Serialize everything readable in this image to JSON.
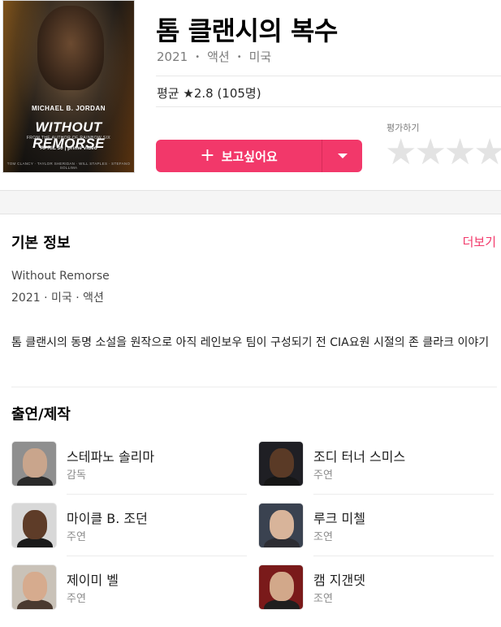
{
  "movie": {
    "title": "톰 클랜시의 복수",
    "year": "2021",
    "genre": "액션",
    "country": "미국",
    "rating_text": "평균 ★2.8 (105명)"
  },
  "poster": {
    "actor": "MICHAEL B. JORDAN",
    "title": "WITHOUT REMORSE",
    "subtitle": "FROM THE AUTHOR OF RAINBOW SIX",
    "release": "APRIL 30 | prime video",
    "credits": "TOM CLANCY · TAYLOR SHERIDAN · WILL STAPLES · STEFANO SOLLIMA"
  },
  "actions": {
    "wishlist_label": "보고싶어요",
    "rate_label": "평가하기",
    "rating_stars": 0,
    "rating_max": 5
  },
  "basic_info": {
    "heading": "기본 정보",
    "more_label": "더보기",
    "original_title": "Without Remorse",
    "meta_line": "2021 · 미국 · 액션",
    "synopsis": "톰 클랜시의 동명 소설을 원작으로 아직 레인보우 팀이 구성되기 전 CIA요원 시절의 존 클라크 이야기"
  },
  "cast": {
    "heading": "출연/제작",
    "people": [
      {
        "name": "스테파노 솔리마",
        "role": "감독",
        "skin": "#c9a58c",
        "bg": "#8f8f8f",
        "shirt": "#2a2a2a"
      },
      {
        "name": "조디 터너 스미스",
        "role": "주연",
        "skin": "#5a3a26",
        "bg": "#1f1f24",
        "shirt": "#161616"
      },
      {
        "name": "마이클 B. 조던",
        "role": "주연",
        "skin": "#5e3c28",
        "bg": "#d8d8d8",
        "shirt": "#1a1a1a"
      },
      {
        "name": "루크 미첼",
        "role": "조연",
        "skin": "#d8b49a",
        "bg": "#3a4250",
        "shirt": "#2d2d33"
      },
      {
        "name": "제이미 벨",
        "role": "주연",
        "skin": "#d6ab8e",
        "bg": "#c9c2b8",
        "shirt": "#4a3a30"
      },
      {
        "name": "캠 지갠뎃",
        "role": "조연",
        "skin": "#d2a88a",
        "bg": "#7a1a1a",
        "shirt": "#1f1f1f"
      }
    ]
  }
}
